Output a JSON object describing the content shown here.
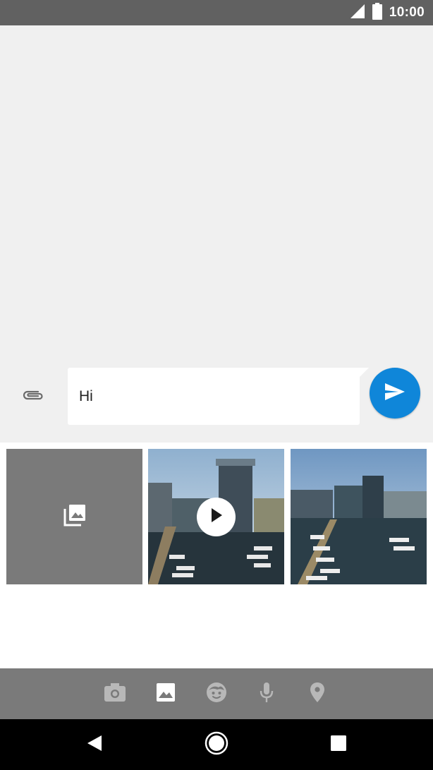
{
  "status_bar": {
    "time": "10:00",
    "icons": [
      "signal-icon",
      "battery-icon"
    ]
  },
  "compose": {
    "text": "Hi",
    "attach_icon": "paperclip-icon",
    "send_icon": "send-icon"
  },
  "media_picker": {
    "tiles": [
      {
        "kind": "gallery",
        "icon": "photo-library-icon"
      },
      {
        "kind": "video",
        "icon": "play-icon"
      },
      {
        "kind": "photo"
      }
    ],
    "toolbar": [
      "camera-icon",
      "image-icon",
      "sticker-icon",
      "microphone-icon",
      "location-icon"
    ],
    "active_tool": "image-icon"
  },
  "nav_bar": [
    "back-icon",
    "home-icon",
    "recents-icon"
  ],
  "colors": {
    "status_bar": "#616161",
    "conversation_bg": "#f0f0f0",
    "send_button": "#0f86d9",
    "toolbar_bg": "#7a7a7a",
    "nav_bar": "#000000"
  }
}
